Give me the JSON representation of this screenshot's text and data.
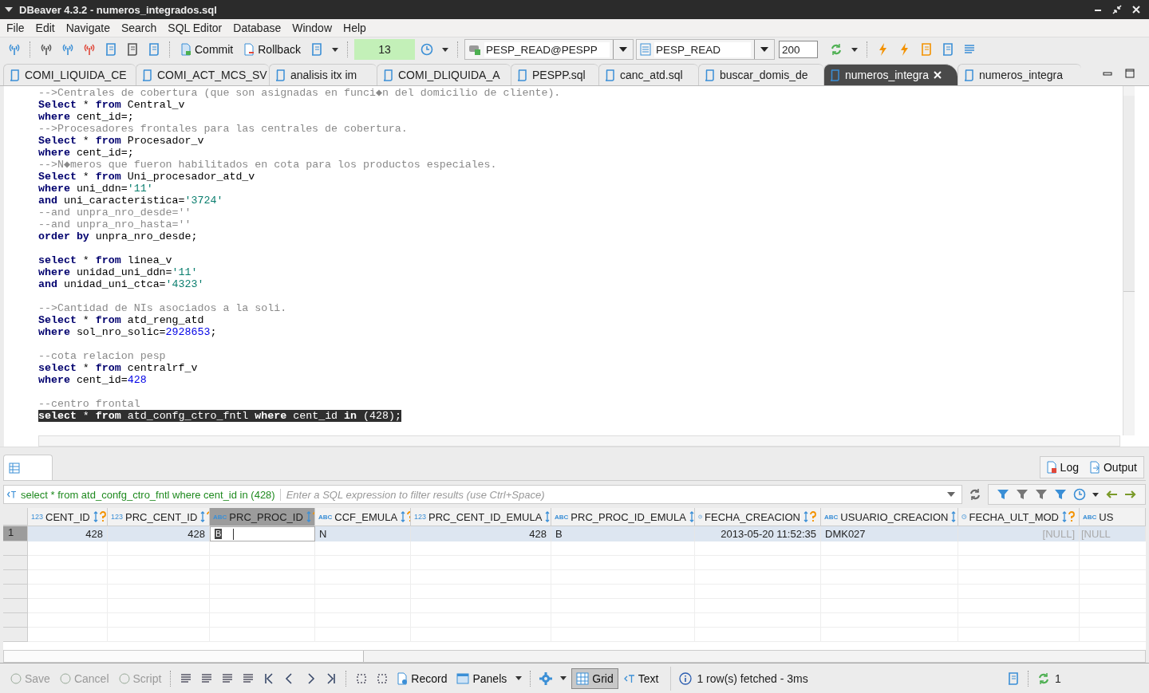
{
  "window": {
    "title": "DBeaver 4.3.2 - numeros_integrados.sql"
  },
  "menu": [
    "File",
    "Edit",
    "Navigate",
    "Search",
    "SQL Editor",
    "Database",
    "Window",
    "Help"
  ],
  "toolbar": {
    "commit": "Commit",
    "rollback": "Rollback",
    "transaction_count": "13",
    "connection": "PESP_READ@PESPP",
    "schema": "PESP_READ",
    "fetch_size": "200"
  },
  "tabs": [
    {
      "label": "COMI_LIQUIDA_CE",
      "selected": false
    },
    {
      "label": "COMI_ACT_MCS_SV",
      "selected": false
    },
    {
      "label": "analisis itx im",
      "selected": false
    },
    {
      "label": "COMI_DLIQUIDA_A",
      "selected": false
    },
    {
      "label": "PESPP.sql",
      "selected": false
    },
    {
      "label": "canc_atd.sql",
      "selected": false
    },
    {
      "label": "buscar_domis_de",
      "selected": false
    },
    {
      "label": "numeros_integra",
      "selected": true
    },
    {
      "label": "numeros_integra",
      "selected": false
    }
  ],
  "editor": {
    "lines": [
      {
        "selected": false,
        "tokens": [
          {
            "kind": "comment",
            "text": "-->Centrales de cobertura (que son asignadas en funci◆n del domicilio de cliente)."
          }
        ]
      },
      {
        "selected": false,
        "tokens": [
          {
            "kind": "keyword",
            "text": "Select"
          },
          {
            "kind": "plain",
            "text": " * "
          },
          {
            "kind": "keyword",
            "text": "from"
          },
          {
            "kind": "plain",
            "text": " Central_v"
          }
        ]
      },
      {
        "selected": false,
        "tokens": [
          {
            "kind": "keyword",
            "text": "where"
          },
          {
            "kind": "plain",
            "text": " cent_id=;"
          }
        ]
      },
      {
        "selected": false,
        "tokens": [
          {
            "kind": "comment",
            "text": "-->Procesadores frontales para las centrales de cobertura."
          }
        ]
      },
      {
        "selected": false,
        "tokens": [
          {
            "kind": "keyword",
            "text": "Select"
          },
          {
            "kind": "plain",
            "text": " * "
          },
          {
            "kind": "keyword",
            "text": "from"
          },
          {
            "kind": "plain",
            "text": " Procesador_v"
          }
        ]
      },
      {
        "selected": false,
        "tokens": [
          {
            "kind": "keyword",
            "text": "where"
          },
          {
            "kind": "plain",
            "text": " cent_id=;"
          }
        ]
      },
      {
        "selected": false,
        "tokens": [
          {
            "kind": "comment",
            "text": "-->N◆meros que fueron habilitados en cota para los productos especiales."
          }
        ]
      },
      {
        "selected": false,
        "tokens": [
          {
            "kind": "keyword",
            "text": "Select"
          },
          {
            "kind": "plain",
            "text": " * "
          },
          {
            "kind": "keyword",
            "text": "from"
          },
          {
            "kind": "plain",
            "text": " Uni_procesador_atd_v"
          }
        ]
      },
      {
        "selected": false,
        "tokens": [
          {
            "kind": "keyword",
            "text": "where"
          },
          {
            "kind": "plain",
            "text": " uni_ddn="
          },
          {
            "kind": "string",
            "text": "'11'"
          }
        ]
      },
      {
        "selected": false,
        "tokens": [
          {
            "kind": "keyword",
            "text": "and"
          },
          {
            "kind": "plain",
            "text": " uni_caracteristica="
          },
          {
            "kind": "string",
            "text": "'3724'"
          }
        ]
      },
      {
        "selected": false,
        "tokens": [
          {
            "kind": "comment",
            "text": "--and unpra_nro_desde=''"
          }
        ]
      },
      {
        "selected": false,
        "tokens": [
          {
            "kind": "comment",
            "text": "--and unpra_nro_hasta=''"
          }
        ]
      },
      {
        "selected": false,
        "tokens": [
          {
            "kind": "keyword",
            "text": "order by"
          },
          {
            "kind": "plain",
            "text": " unpra_nro_desde;"
          }
        ]
      },
      {
        "selected": false
      },
      {
        "selected": false,
        "tokens": [
          {
            "kind": "keyword",
            "text": "select"
          },
          {
            "kind": "plain",
            "text": " * "
          },
          {
            "kind": "keyword",
            "text": "from"
          },
          {
            "kind": "plain",
            "text": " linea_v"
          }
        ]
      },
      {
        "selected": false,
        "tokens": [
          {
            "kind": "keyword",
            "text": "where"
          },
          {
            "kind": "plain",
            "text": " unidad_uni_ddn="
          },
          {
            "kind": "string",
            "text": "'11'"
          }
        ]
      },
      {
        "selected": false,
        "tokens": [
          {
            "kind": "keyword",
            "text": "and"
          },
          {
            "kind": "plain",
            "text": " unidad_uni_ctca="
          },
          {
            "kind": "string",
            "text": "'4323'"
          }
        ]
      },
      {
        "selected": false
      },
      {
        "selected": false,
        "tokens": [
          {
            "kind": "comment",
            "text": "-->Cantidad de NIs asociados a la soli."
          }
        ]
      },
      {
        "selected": false,
        "tokens": [
          {
            "kind": "keyword",
            "text": "Select"
          },
          {
            "kind": "plain",
            "text": " * "
          },
          {
            "kind": "keyword",
            "text": "from"
          },
          {
            "kind": "plain",
            "text": " atd_reng_atd"
          }
        ]
      },
      {
        "selected": false,
        "tokens": [
          {
            "kind": "keyword",
            "text": "where"
          },
          {
            "kind": "plain",
            "text": " sol_nro_solic="
          },
          {
            "kind": "number",
            "text": "2928653"
          },
          {
            "kind": "plain",
            "text": ";"
          }
        ]
      },
      {
        "selected": false
      },
      {
        "selected": false,
        "tokens": [
          {
            "kind": "comment",
            "text": "--cota relacion pesp"
          }
        ]
      },
      {
        "selected": false,
        "tokens": [
          {
            "kind": "keyword",
            "text": "select"
          },
          {
            "kind": "plain",
            "text": " * "
          },
          {
            "kind": "keyword",
            "text": "from"
          },
          {
            "kind": "plain",
            "text": " centralrf_v"
          }
        ]
      },
      {
        "selected": false,
        "tokens": [
          {
            "kind": "keyword",
            "text": "where"
          },
          {
            "kind": "plain",
            "text": " cent_id="
          },
          {
            "kind": "number",
            "text": "428"
          }
        ]
      },
      {
        "selected": false
      },
      {
        "selected": false,
        "tokens": [
          {
            "kind": "comment",
            "text": "--centro frontal"
          }
        ]
      },
      {
        "selected": true,
        "tokens": [
          {
            "kind": "keyword",
            "text": "select"
          },
          {
            "kind": "plain",
            "text": " * "
          },
          {
            "kind": "keyword",
            "text": "from"
          },
          {
            "kind": "plain",
            "text": " atd_confg_ctro_fntl "
          },
          {
            "kind": "keyword",
            "text": "where"
          },
          {
            "kind": "plain",
            "text": " cent_id "
          },
          {
            "kind": "keyword",
            "text": "in"
          },
          {
            "kind": "plain",
            "text": " (428);"
          }
        ]
      }
    ]
  },
  "results": {
    "log": "Log",
    "output": "Output",
    "query": "select * from atd_confg_ctro_fntl where cent_id in (428)",
    "filter": {
      "placeholder": "Enter a SQL expression to filter results (use Ctrl+Space)"
    },
    "columns": [
      {
        "name": "CENT_ID",
        "kind": "number",
        "type_label": "123",
        "selected": false
      },
      {
        "name": "PRC_CENT_ID",
        "kind": "number",
        "type_label": "123",
        "selected": false
      },
      {
        "name": "PRC_PROC_ID",
        "kind": "text",
        "type_label": "ABC",
        "selected": true
      },
      {
        "name": "CCF_EMULA",
        "kind": "text",
        "type_label": "ABC",
        "selected": false
      },
      {
        "name": "PRC_CENT_ID_EMULA",
        "kind": "number",
        "type_label": "123",
        "selected": false
      },
      {
        "name": "PRC_PROC_ID_EMULA",
        "kind": "text",
        "type_label": "ABC",
        "selected": false
      },
      {
        "name": "FECHA_CREACION",
        "kind": "date",
        "selected": false
      },
      {
        "name": "USUARIO_CREACION",
        "kind": "text",
        "type_label": "ABC",
        "selected": false
      },
      {
        "name": "FECHA_ULT_MOD",
        "kind": "date",
        "selected": false
      },
      {
        "name": "US",
        "kind": "text",
        "type_label": "ABC",
        "selected": false
      }
    ],
    "rows": [
      {
        "number": "1",
        "cells": [
          {
            "value": "428",
            "kind": "number",
            "editing": false
          },
          {
            "value": "428",
            "kind": "number",
            "editing": false
          },
          {
            "value": "B",
            "kind": "text",
            "editing": true
          },
          {
            "value": "N",
            "kind": "text",
            "editing": false
          },
          {
            "value": "428",
            "kind": "number",
            "editing": false
          },
          {
            "value": "B",
            "kind": "text",
            "editing": false
          },
          {
            "value": "2013-05-20 11:52:35",
            "kind": "number",
            "editing": false
          },
          {
            "value": "DMK027",
            "kind": "text",
            "editing": false
          },
          {
            "value": "[NULL]",
            "kind": "null",
            "editing": false
          },
          {
            "value": "[NULL",
            "kind": "null",
            "editing": false
          }
        ]
      }
    ]
  },
  "bottom_toolbar": {
    "edit_buttons": [
      {
        "label": "Save",
        "disabled": true
      },
      {
        "label": "Cancel",
        "disabled": true
      },
      {
        "label": "Script",
        "disabled": true
      }
    ],
    "record": "Record",
    "panels": "Panels",
    "views": [
      {
        "label": "Grid",
        "selected": true
      },
      {
        "label": "Text",
        "selected": false
      }
    ],
    "status": "1 row(s) fetched - 3ms",
    "count": "1"
  }
}
